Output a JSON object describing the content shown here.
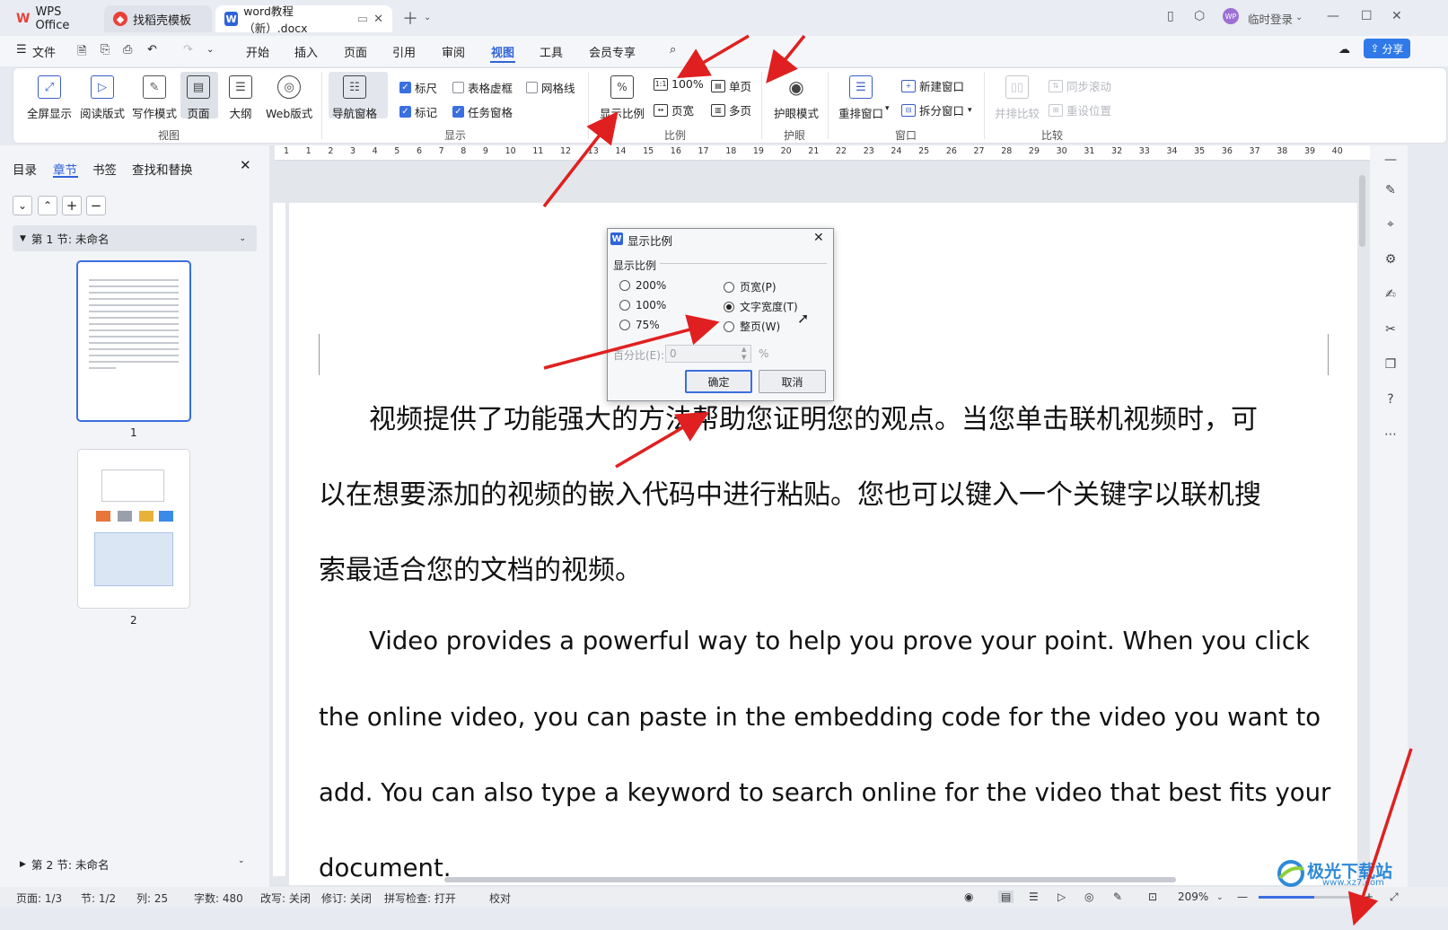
{
  "tabs": [
    {
      "label": "WPS Office"
    },
    {
      "label": "找稻壳模板"
    },
    {
      "label": "word教程（新）.docx"
    }
  ],
  "titlebar": {
    "login": "临时登录"
  },
  "menu": {
    "file": "文件",
    "items": [
      "开始",
      "插入",
      "页面",
      "引用",
      "审阅",
      "视图",
      "工具",
      "会员专享"
    ],
    "active": "视图",
    "share": "分享"
  },
  "ribbon": {
    "view_buttons": [
      "全屏显示",
      "阅读版式",
      "写作模式",
      "页面",
      "大纲",
      "Web版式"
    ],
    "nav_pane": "导航窗格",
    "checkboxes": [
      {
        "label": "标尺",
        "checked": true
      },
      {
        "label": "表格虚框",
        "checked": false
      },
      {
        "label": "网格线",
        "checked": false
      },
      {
        "label": "标记",
        "checked": true
      },
      {
        "label": "任务窗格",
        "checked": true
      }
    ],
    "zoom_dialog": "显示比例",
    "zoom_100": "100%",
    "page_width": "页宽",
    "single_page": "单页",
    "multi_page": "多页",
    "eye_protect": "护眼模式",
    "arrange": "重排窗口",
    "new_window": "新建窗口",
    "split_window": "拆分窗口",
    "side_by_side": "并排比较",
    "sync_scroll": "同步滚动",
    "reset_pos": "重设位置",
    "groups": [
      "视图",
      "显示",
      "比例",
      "护眼",
      "窗口",
      "比较"
    ]
  },
  "left_panel": {
    "tabs": [
      "目录",
      "章节",
      "书签",
      "查找和替换"
    ],
    "active_tab": "章节",
    "section1": "第 1 节: 未命名",
    "section2": "第 2 节: 未命名",
    "page_numbers": [
      "1",
      "2"
    ]
  },
  "document": {
    "para1_lines": [
      "视频提供了功能强大的方法帮助您证明您的观点。当您单击联机视频时，可",
      "以在想要添加的视频的嵌入代码中进行粘贴。您也可以键入一个关键字以联机搜",
      "索最适合您的文档的视频。"
    ],
    "para2_lines": [
      "Video provides a powerful way to help you prove your point. When you click",
      "the online video, you can paste in the embedding code for the video you want to",
      "add. You can also type a keyword to search online for the video that best fits your",
      "document."
    ]
  },
  "dialog": {
    "title": "显示比例",
    "group": "显示比例",
    "options": [
      "200%",
      "100%",
      "75%",
      "页宽(P)",
      "文字宽度(T)",
      "整页(W)"
    ],
    "selected": "文字宽度(T)",
    "percent_label": "百分比(E):",
    "percent_value": "0",
    "percent_unit": "%",
    "ok": "确定",
    "cancel": "取消"
  },
  "statusbar": {
    "page": "页面: 1/3",
    "section": "节: 1/2",
    "column": "列: 25",
    "words": "字数: 480",
    "revise": "改写: 关闭",
    "track": "修订: 关闭",
    "spell": "拼写检查: 打开",
    "proof": "校对",
    "zoom": "209%"
  },
  "watermark": "极光下载站",
  "watermark_url": "www.xz7.com",
  "colors": {
    "accent": "#3a6fe0",
    "arrow": "#e02020",
    "wps_red": "#e8413a"
  }
}
